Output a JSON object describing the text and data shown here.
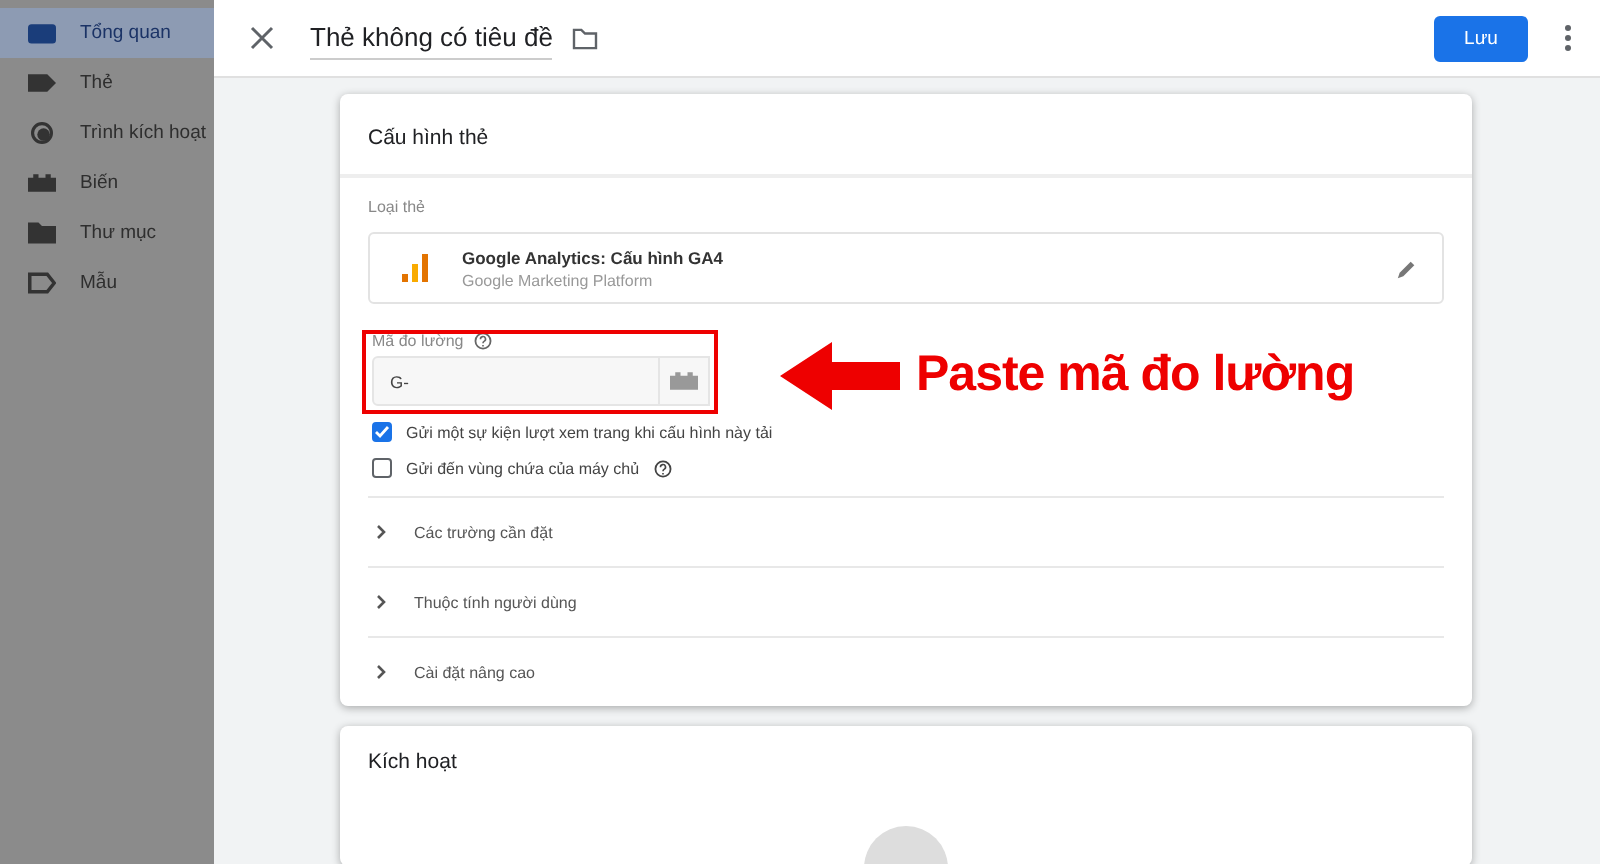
{
  "sidebar": {
    "items": [
      {
        "label": "Tổng quan",
        "selected": true
      },
      {
        "label": "Thẻ",
        "selected": false
      },
      {
        "label": "Trình kích hoạt",
        "selected": false
      },
      {
        "label": "Biến",
        "selected": false
      },
      {
        "label": "Thư mục",
        "selected": false
      },
      {
        "label": "Mẫu",
        "selected": false
      }
    ]
  },
  "header": {
    "title": "Thẻ không có tiêu đề",
    "save_button": "Lưu"
  },
  "tag_config": {
    "title": "Cấu hình thẻ",
    "tag_type_label": "Loại thẻ",
    "tag_type_name": "Google Analytics: Cấu hình GA4",
    "tag_type_vendor": "Google Marketing Platform",
    "measurement_id": {
      "label": "Mã đo lường",
      "value": "G-"
    },
    "checkboxes": [
      {
        "label": "Gửi một sự kiện lượt xem trang khi cấu hình này tải",
        "checked": true,
        "help": false
      },
      {
        "label": "Gửi đến vùng chứa của máy chủ",
        "checked": false,
        "help": true
      }
    ],
    "sections": [
      {
        "label": "Các trường cần đặt"
      },
      {
        "label": "Thuộc tính người dùng"
      },
      {
        "label": "Cài đặt nâng cao"
      }
    ]
  },
  "triggering": {
    "title": "Kích hoạt"
  },
  "annotation": {
    "text": "Paste mã đo lường"
  }
}
